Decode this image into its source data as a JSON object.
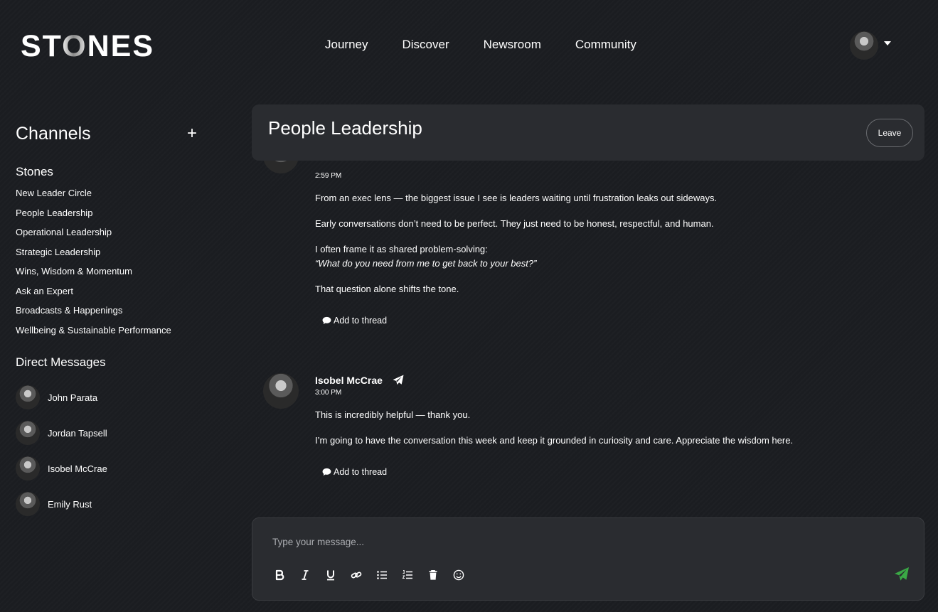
{
  "brand": {
    "logo_pre": "ST",
    "logo_o": "O",
    "logo_post": "NES"
  },
  "nav": [
    "Journey",
    "Discover",
    "Newsroom",
    "Community"
  ],
  "sidebar": {
    "channels_title": "Channels",
    "add_icon": "+",
    "group_title": "Stones",
    "channels": [
      "New Leader Circle",
      "People Leadership",
      "Operational Leadership",
      "Strategic Leadership",
      "Wins, Wisdom & Momentum",
      "Ask an Expert",
      "Broadcasts & Happenings",
      "Wellbeing & Sustainable Performance"
    ],
    "dm_title": "Direct Messages",
    "direct_messages": [
      "John Parata",
      "Jordan Tapsell",
      "Isobel McCrae",
      "Emily Rust"
    ]
  },
  "channel": {
    "title": "People Leadership",
    "leave_label": "Leave"
  },
  "messages": [
    {
      "time": "2:59 PM",
      "lines": [
        "From an exec lens — the biggest issue I see is leaders waiting until frustration leaks out sideways.",
        "Early conversations don’t need to be perfect. They just need to be honest, respectful, and human.",
        "I often frame it as shared problem-solving:",
        "“What do you need from me to get back to your best?”",
        "That question alone shifts the tone."
      ],
      "thread_label": "Add to thread"
    },
    {
      "author": "Isobel McCrae",
      "time": "3:00 PM",
      "lines": [
        "This is incredibly helpful — thank you.",
        "I’m going to have the conversation this week and keep it grounded in curiosity and care. Appreciate the wisdom here."
      ],
      "thread_label": "Add to thread"
    }
  ],
  "composer": {
    "placeholder": "Type your message...",
    "tools": [
      "bold-icon",
      "italic-icon",
      "underline-icon",
      "link-icon",
      "bullet-list-icon",
      "numbered-list-icon",
      "trash-icon",
      "emoji-icon"
    ],
    "send_icon": "send-icon"
  },
  "colors": {
    "background": "#1b1d21",
    "panel": "#2a2c30",
    "send_accent": "#3aa845"
  }
}
